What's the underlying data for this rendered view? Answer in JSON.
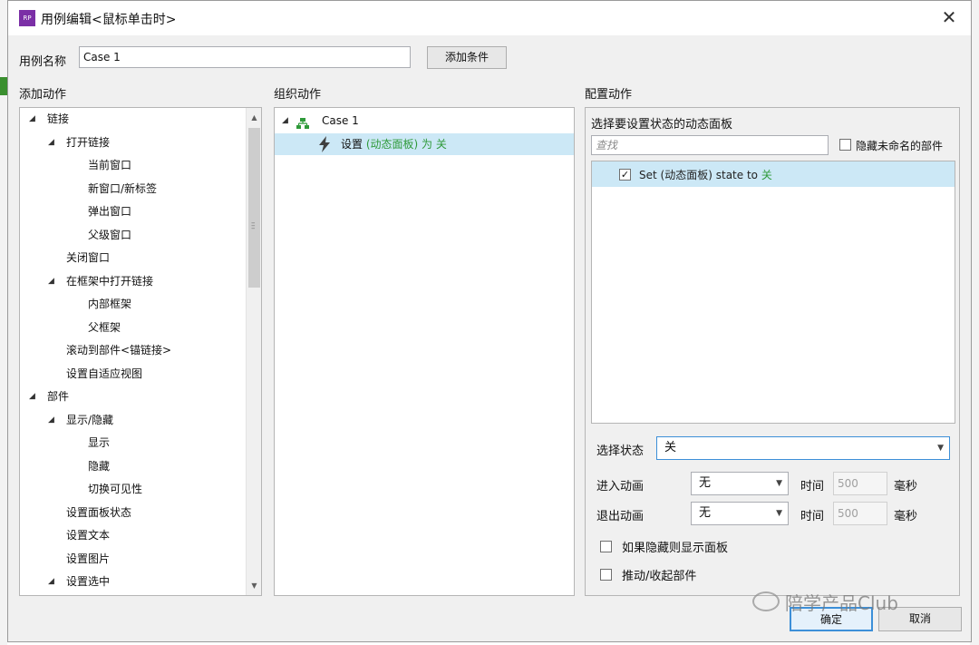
{
  "window": {
    "title": "用例编辑<鼠标单击时>",
    "app_icon": "RP",
    "close_glyph": "✕"
  },
  "case": {
    "name_label": "用例名称",
    "name_value": "Case 1",
    "add_condition_button": "添加条件"
  },
  "sections": {
    "add_action": "添加动作",
    "organize_action": "组织动作",
    "configure_action": "配置动作"
  },
  "action_tree": [
    {
      "label": "链接",
      "level": 0,
      "expanded": true
    },
    {
      "label": "打开链接",
      "level": 1,
      "expanded": true
    },
    {
      "label": "当前窗口",
      "level": 2
    },
    {
      "label": "新窗口/新标签",
      "level": 2
    },
    {
      "label": "弹出窗口",
      "level": 2
    },
    {
      "label": "父级窗口",
      "level": 2
    },
    {
      "label": "关闭窗口",
      "level": 1
    },
    {
      "label": "在框架中打开链接",
      "level": 1,
      "expanded": true
    },
    {
      "label": "内部框架",
      "level": 2
    },
    {
      "label": "父框架",
      "level": 2
    },
    {
      "label": "滚动到部件<锚链接>",
      "level": 1
    },
    {
      "label": "设置自适应视图",
      "level": 1
    },
    {
      "label": "部件",
      "level": 0,
      "expanded": true
    },
    {
      "label": "显示/隐藏",
      "level": 1,
      "expanded": true
    },
    {
      "label": "显示",
      "level": 2
    },
    {
      "label": "隐藏",
      "level": 2
    },
    {
      "label": "切换可见性",
      "level": 2
    },
    {
      "label": "设置面板状态",
      "level": 1
    },
    {
      "label": "设置文本",
      "level": 1
    },
    {
      "label": "设置图片",
      "level": 1
    },
    {
      "label": "设置选中",
      "level": 1,
      "expanded": true
    }
  ],
  "organize": {
    "case_label": "Case 1",
    "action_prefix": "设置",
    "action_target": "(动态面板)",
    "action_middle": "为",
    "action_value": "关"
  },
  "configure": {
    "panel_heading": "选择要设置状态的动态面板",
    "search_placeholder": "查找",
    "hide_unnamed_label": "隐藏未命名的部件",
    "item_prefix": "Set",
    "item_target": "(动态面板)",
    "item_middle": "state to",
    "item_value": "关",
    "item_checked": true,
    "select_state_label": "选择状态",
    "select_state_value": "关",
    "enter_anim_label": "进入动画",
    "enter_anim_value": "无",
    "exit_anim_label": "退出动画",
    "exit_anim_value": "无",
    "time_label": "时间",
    "time_value": "500",
    "ms_label": "毫秒",
    "show_if_hidden_label": "如果隐藏则显示面板",
    "push_pull_label": "推动/收起部件"
  },
  "footer": {
    "ok_button": "确定",
    "cancel_button": "取消"
  },
  "watermark": {
    "text": "陪学产品Club"
  },
  "colors": {
    "accent_green": "#2f9a3a",
    "selection": "#cce8f6",
    "app_icon": "#7b2fa6"
  }
}
